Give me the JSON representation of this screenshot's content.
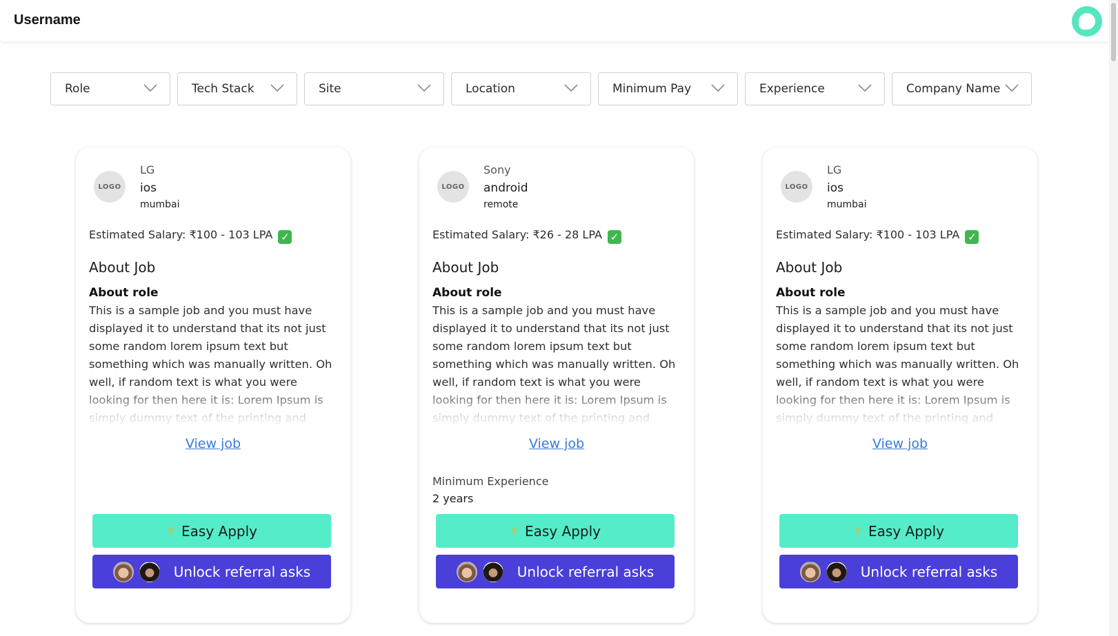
{
  "header": {
    "username": "Username",
    "avatar_icon": "user-avatar-icon"
  },
  "filters": [
    {
      "label": "Role"
    },
    {
      "label": "Tech Stack"
    },
    {
      "label": "Site"
    },
    {
      "label": "Location"
    },
    {
      "label": "Minimum Pay"
    },
    {
      "label": "Experience"
    },
    {
      "label": "Company Name"
    }
  ],
  "jobs": [
    {
      "logo_text": "LOGO",
      "company": "LG",
      "role": "ios",
      "location": "mumbai",
      "salary": "Estimated Salary: ₹100 - 103 LPA",
      "about_job": "About Job",
      "about_role": "About role",
      "description": "This is a sample job and you must have displayed it to understand that its not just some random lorem ipsum text but something which was manually written. Oh well, if random text is what you were looking for then here it is: Lorem Ipsum is simply dummy text of the printing and typesetting industry. Lorem Ipsum has been the",
      "view_job": "View job",
      "min_exp_label": "",
      "min_exp_value": "",
      "easy_apply": "Easy Apply",
      "referral": "Unlock referral asks"
    },
    {
      "logo_text": "LOGO",
      "company": "Sony",
      "role": "android",
      "location": "remote",
      "salary": "Estimated Salary: ₹26 - 28 LPA",
      "about_job": "About Job",
      "about_role": "About role",
      "description": "This is a sample job and you must have displayed it to understand that its not just some random lorem ipsum text but something which was manually written. Oh well, if random text is what you were looking for then here it is: Lorem Ipsum is simply dummy text of the printing and typesetting industry. Lorem Ipsum has been the",
      "view_job": "View job",
      "min_exp_label": "Minimum Experience",
      "min_exp_value": "2 years",
      "easy_apply": "Easy Apply",
      "referral": "Unlock referral asks"
    },
    {
      "logo_text": "LOGO",
      "company": "LG",
      "role": "ios",
      "location": "mumbai",
      "salary": "Estimated Salary: ₹100 - 103 LPA",
      "about_job": "About Job",
      "about_role": "About role",
      "description": "This is a sample job and you must have displayed it to understand that its not just some random lorem ipsum text but something which was manually written. Oh well, if random text is what you were looking for then here it is: Lorem Ipsum is simply dummy text of the printing and typesetting industry. Lorem Ipsum has been the",
      "view_job": "View job",
      "min_exp_label": "",
      "min_exp_value": "",
      "easy_apply": "Easy Apply",
      "referral": "Unlock referral asks"
    }
  ],
  "colors": {
    "accent_green": "#55ecc9",
    "accent_purple": "#4a3fd8",
    "link_blue": "#3a78d8"
  }
}
